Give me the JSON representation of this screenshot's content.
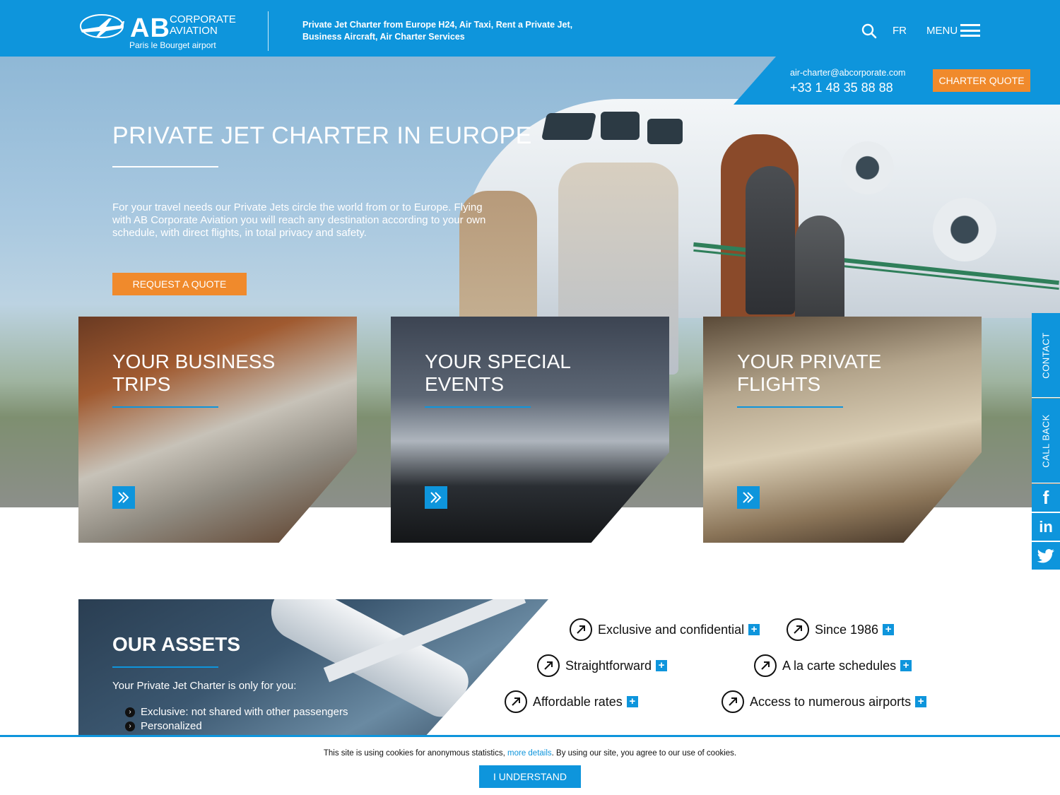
{
  "header": {
    "logo": {
      "ab": "AB",
      "corporate": "CORPORATE",
      "aviation": "AVIATION",
      "location": "Paris le Bourget airport"
    },
    "tagline": "Private Jet Charter from Europe H24, Air Taxi, Rent a Private Jet, Business Aircraft, Air Charter Services",
    "search_icon": "search-icon",
    "lang": "FR",
    "menu_label": "MENU"
  },
  "contact_band": {
    "email": "air-charter@abcorporate.com",
    "phone": "+33 1 48 35 88 88",
    "quote_btn": "CHARTER QUOTE"
  },
  "hero": {
    "title": "PRIVATE JET CHARTER IN EUROPE",
    "text": "For your travel needs our Private Jets circle the world from or to Europe. Flying with AB Corporate Aviation you will reach any destination according to your own schedule, with direct flights, in total privacy and safety.",
    "button": "REQUEST A QUOTE"
  },
  "cards": [
    {
      "title_1": "YOUR BUSINESS",
      "title_2": "TRIPS"
    },
    {
      "title_1": "YOUR SPECIAL",
      "title_2": "EVENTS"
    },
    {
      "title_1": "YOUR PRIVATE",
      "title_2": "FLIGHTS"
    }
  ],
  "side": {
    "contact": "CONTACT",
    "callback": "CALL BACK"
  },
  "social": {
    "facebook": "f",
    "linkedin": "in"
  },
  "assets": {
    "title": "OUR ASSETS",
    "subtitle": "Your Private Jet Charter is only for you:",
    "items": [
      "Exclusive: not shared with other passengers",
      "Personalized"
    ]
  },
  "features": [
    "Exclusive and confidential",
    "Since 1986",
    "Straightforward",
    "A la carte schedules",
    "Affordable rates",
    "Access to numerous airports"
  ],
  "cookie": {
    "text_before": "This site is using cookies for anonymous statistics, ",
    "link": "more details",
    "text_after": ". By using our site, you agree to our use of cookies.",
    "button": "I UNDERSTAND"
  },
  "colors": {
    "brand_blue": "#0e95dc",
    "accent_orange": "#f08a2c"
  }
}
